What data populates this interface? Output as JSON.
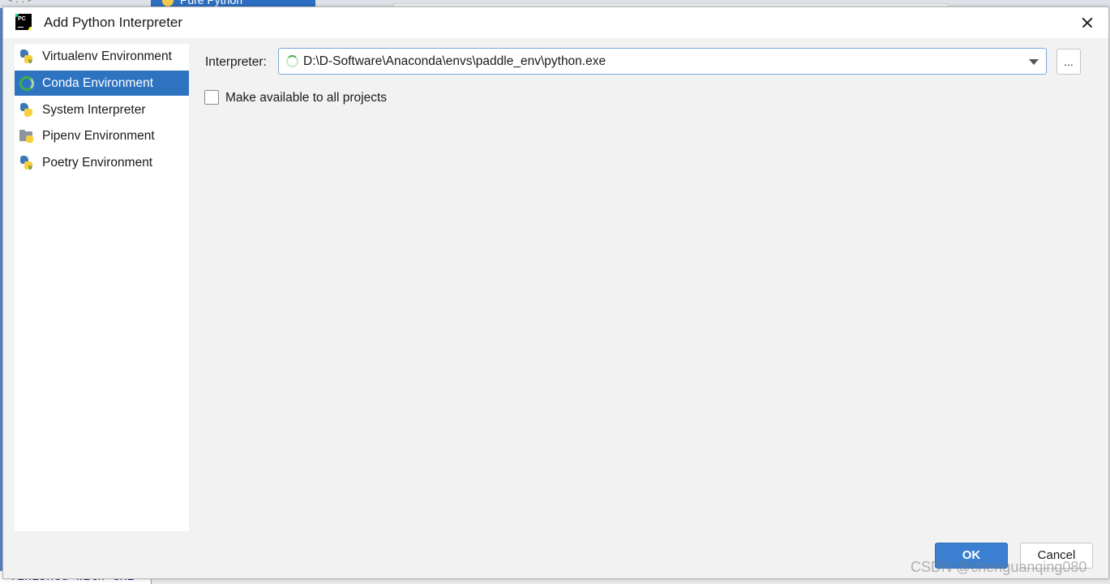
{
  "background": {
    "tab_label": "Pure Python",
    "left_text": "< . . >",
    "console_text": "finished with exi"
  },
  "dialog": {
    "title": "Add Python Interpreter",
    "app_icon_text": "PC"
  },
  "sidebar": {
    "items": [
      {
        "label": "Virtualenv Environment",
        "icon": "virtualenv-python-icon",
        "selected": false
      },
      {
        "label": "Conda Environment",
        "icon": "conda-icon",
        "selected": true
      },
      {
        "label": "System Interpreter",
        "icon": "python-icon",
        "selected": false
      },
      {
        "label": "Pipenv Environment",
        "icon": "pipenv-folder-icon",
        "selected": false
      },
      {
        "label": "Poetry Environment",
        "icon": "poetry-python-icon",
        "selected": false
      }
    ]
  },
  "main": {
    "interpreter_label": "Interpreter:",
    "interpreter_value": "D:\\D-Software\\Anaconda\\envs\\paddle_env\\python.exe",
    "browse_label": "...",
    "make_available_label": "Make available to all projects",
    "make_available_checked": false
  },
  "footer": {
    "ok_label": "OK",
    "cancel_label": "Cancel"
  },
  "watermark": "CSDN @chenguanqing080",
  "colors": {
    "accent": "#2e73c0",
    "ok_button": "#3b7fd0",
    "conda_green": "#3fae49"
  }
}
